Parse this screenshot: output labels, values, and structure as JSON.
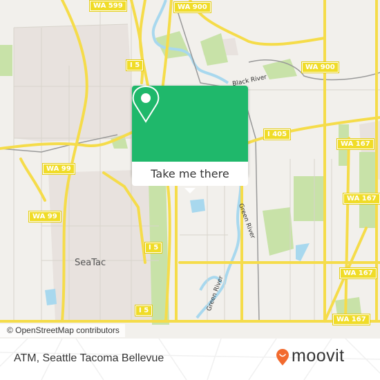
{
  "map": {
    "attribution": "© OpenStreetMap contributors",
    "place_labels": [
      {
        "id": "seatac",
        "text": "SeaTac"
      }
    ],
    "river_labels": [
      {
        "id": "black-river",
        "text": "Black River"
      },
      {
        "id": "green-river-1",
        "text": "Green River"
      },
      {
        "id": "green-river-2",
        "text": "Green River"
      }
    ],
    "road_shields": [
      {
        "id": "wa599",
        "text": "WA 599"
      },
      {
        "id": "wa900-top",
        "text": "WA 900"
      },
      {
        "id": "wa900-mid",
        "text": "WA 900"
      },
      {
        "id": "i5-top",
        "text": "I 5"
      },
      {
        "id": "i405",
        "text": "I 405"
      },
      {
        "id": "wa167-1",
        "text": "WA 167"
      },
      {
        "id": "wa99-1",
        "text": "WA 99"
      },
      {
        "id": "wa99-2",
        "text": "WA 99"
      },
      {
        "id": "wa167-2",
        "text": "WA 167"
      },
      {
        "id": "i5-mid",
        "text": "I 5"
      },
      {
        "id": "wa167-3",
        "text": "WA 167"
      },
      {
        "id": "i5-low",
        "text": "I 5"
      },
      {
        "id": "wa167-4",
        "text": "WA 167"
      }
    ],
    "colors": {
      "background": "#f2f0ec",
      "highway": "#f5dc4a",
      "water": "#a8d8ee",
      "park": "#c8e2a8",
      "urban": "#e8e2de"
    }
  },
  "popup": {
    "icon": "map-pin-icon",
    "button_label": "Take me there",
    "color": "#1fb86b"
  },
  "footer": {
    "title": "ATM, Seattle Tacoma Bellevue",
    "logo_text": "moovit",
    "logo_color": "#f26a2e"
  }
}
